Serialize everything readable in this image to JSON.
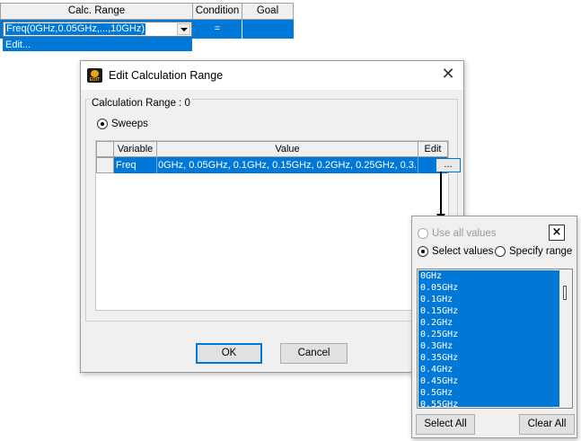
{
  "grid": {
    "headers": [
      "Calc. Range",
      "Condition",
      "Goal"
    ],
    "range_value": "Freq(0GHz,0.05GHz,...,10GHz)",
    "condition_value": "=",
    "dropdown_item": "Edit..."
  },
  "dialog": {
    "title": "Edit Calculation Range",
    "close_glyph": "✕",
    "group_label": "Calculation Range : 0",
    "sweeps_label": "Sweeps",
    "columns": [
      "Variable",
      "Value",
      "Edit"
    ],
    "row": {
      "variable": "Freq",
      "value": "0GHz, 0.05GHz, 0.1GHz, 0.15GHz, 0.2GHz, 0.25GHz, 0.3...",
      "edit_label": "..."
    },
    "ok_label": "OK",
    "cancel_label": "Cancel"
  },
  "popup": {
    "close_glyph": "×",
    "use_all_label": "Use all values",
    "select_values_label": "Select values",
    "specify_range_label": "Specify range",
    "values": [
      "0GHz",
      "0.05GHz",
      "0.1GHz",
      "0.15GHz",
      "0.2GHz",
      "0.25GHz",
      "0.3GHz",
      "0.35GHz",
      "0.4GHz",
      "0.45GHz",
      "0.5GHz",
      "0.55GHz"
    ],
    "select_all_label": "Select All",
    "clear_all_label": "Clear All"
  },
  "colors": {
    "selection": "#0078d7",
    "dialog_bg": "#f0f0f0"
  }
}
